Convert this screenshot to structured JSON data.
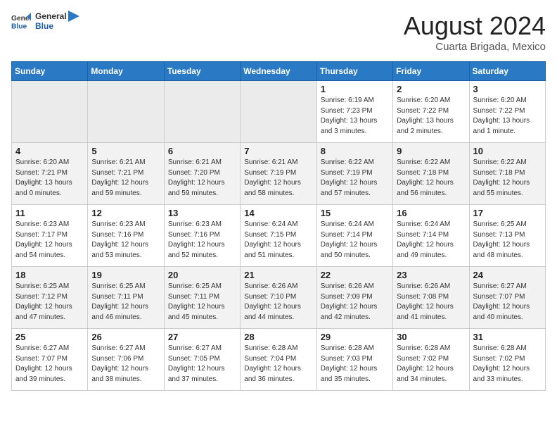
{
  "header": {
    "logo_general": "General",
    "logo_blue": "Blue",
    "month_year": "August 2024",
    "location": "Cuarta Brigada, Mexico"
  },
  "weekdays": [
    "Sunday",
    "Monday",
    "Tuesday",
    "Wednesday",
    "Thursday",
    "Friday",
    "Saturday"
  ],
  "weeks": [
    [
      {
        "day": "",
        "info": ""
      },
      {
        "day": "",
        "info": ""
      },
      {
        "day": "",
        "info": ""
      },
      {
        "day": "",
        "info": ""
      },
      {
        "day": "1",
        "info": "Sunrise: 6:19 AM\nSunset: 7:23 PM\nDaylight: 13 hours\nand 3 minutes."
      },
      {
        "day": "2",
        "info": "Sunrise: 6:20 AM\nSunset: 7:22 PM\nDaylight: 13 hours\nand 2 minutes."
      },
      {
        "day": "3",
        "info": "Sunrise: 6:20 AM\nSunset: 7:22 PM\nDaylight: 13 hours\nand 1 minute."
      }
    ],
    [
      {
        "day": "4",
        "info": "Sunrise: 6:20 AM\nSunset: 7:21 PM\nDaylight: 13 hours\nand 0 minutes."
      },
      {
        "day": "5",
        "info": "Sunrise: 6:21 AM\nSunset: 7:21 PM\nDaylight: 12 hours\nand 59 minutes."
      },
      {
        "day": "6",
        "info": "Sunrise: 6:21 AM\nSunset: 7:20 PM\nDaylight: 12 hours\nand 59 minutes."
      },
      {
        "day": "7",
        "info": "Sunrise: 6:21 AM\nSunset: 7:19 PM\nDaylight: 12 hours\nand 58 minutes."
      },
      {
        "day": "8",
        "info": "Sunrise: 6:22 AM\nSunset: 7:19 PM\nDaylight: 12 hours\nand 57 minutes."
      },
      {
        "day": "9",
        "info": "Sunrise: 6:22 AM\nSunset: 7:18 PM\nDaylight: 12 hours\nand 56 minutes."
      },
      {
        "day": "10",
        "info": "Sunrise: 6:22 AM\nSunset: 7:18 PM\nDaylight: 12 hours\nand 55 minutes."
      }
    ],
    [
      {
        "day": "11",
        "info": "Sunrise: 6:23 AM\nSunset: 7:17 PM\nDaylight: 12 hours\nand 54 minutes."
      },
      {
        "day": "12",
        "info": "Sunrise: 6:23 AM\nSunset: 7:16 PM\nDaylight: 12 hours\nand 53 minutes."
      },
      {
        "day": "13",
        "info": "Sunrise: 6:23 AM\nSunset: 7:16 PM\nDaylight: 12 hours\nand 52 minutes."
      },
      {
        "day": "14",
        "info": "Sunrise: 6:24 AM\nSunset: 7:15 PM\nDaylight: 12 hours\nand 51 minutes."
      },
      {
        "day": "15",
        "info": "Sunrise: 6:24 AM\nSunset: 7:14 PM\nDaylight: 12 hours\nand 50 minutes."
      },
      {
        "day": "16",
        "info": "Sunrise: 6:24 AM\nSunset: 7:14 PM\nDaylight: 12 hours\nand 49 minutes."
      },
      {
        "day": "17",
        "info": "Sunrise: 6:25 AM\nSunset: 7:13 PM\nDaylight: 12 hours\nand 48 minutes."
      }
    ],
    [
      {
        "day": "18",
        "info": "Sunrise: 6:25 AM\nSunset: 7:12 PM\nDaylight: 12 hours\nand 47 minutes."
      },
      {
        "day": "19",
        "info": "Sunrise: 6:25 AM\nSunset: 7:11 PM\nDaylight: 12 hours\nand 46 minutes."
      },
      {
        "day": "20",
        "info": "Sunrise: 6:25 AM\nSunset: 7:11 PM\nDaylight: 12 hours\nand 45 minutes."
      },
      {
        "day": "21",
        "info": "Sunrise: 6:26 AM\nSunset: 7:10 PM\nDaylight: 12 hours\nand 44 minutes."
      },
      {
        "day": "22",
        "info": "Sunrise: 6:26 AM\nSunset: 7:09 PM\nDaylight: 12 hours\nand 42 minutes."
      },
      {
        "day": "23",
        "info": "Sunrise: 6:26 AM\nSunset: 7:08 PM\nDaylight: 12 hours\nand 41 minutes."
      },
      {
        "day": "24",
        "info": "Sunrise: 6:27 AM\nSunset: 7:07 PM\nDaylight: 12 hours\nand 40 minutes."
      }
    ],
    [
      {
        "day": "25",
        "info": "Sunrise: 6:27 AM\nSunset: 7:07 PM\nDaylight: 12 hours\nand 39 minutes."
      },
      {
        "day": "26",
        "info": "Sunrise: 6:27 AM\nSunset: 7:06 PM\nDaylight: 12 hours\nand 38 minutes."
      },
      {
        "day": "27",
        "info": "Sunrise: 6:27 AM\nSunset: 7:05 PM\nDaylight: 12 hours\nand 37 minutes."
      },
      {
        "day": "28",
        "info": "Sunrise: 6:28 AM\nSunset: 7:04 PM\nDaylight: 12 hours\nand 36 minutes."
      },
      {
        "day": "29",
        "info": "Sunrise: 6:28 AM\nSunset: 7:03 PM\nDaylight: 12 hours\nand 35 minutes."
      },
      {
        "day": "30",
        "info": "Sunrise: 6:28 AM\nSunset: 7:02 PM\nDaylight: 12 hours\nand 34 minutes."
      },
      {
        "day": "31",
        "info": "Sunrise: 6:28 AM\nSunset: 7:02 PM\nDaylight: 12 hours\nand 33 minutes."
      }
    ]
  ]
}
